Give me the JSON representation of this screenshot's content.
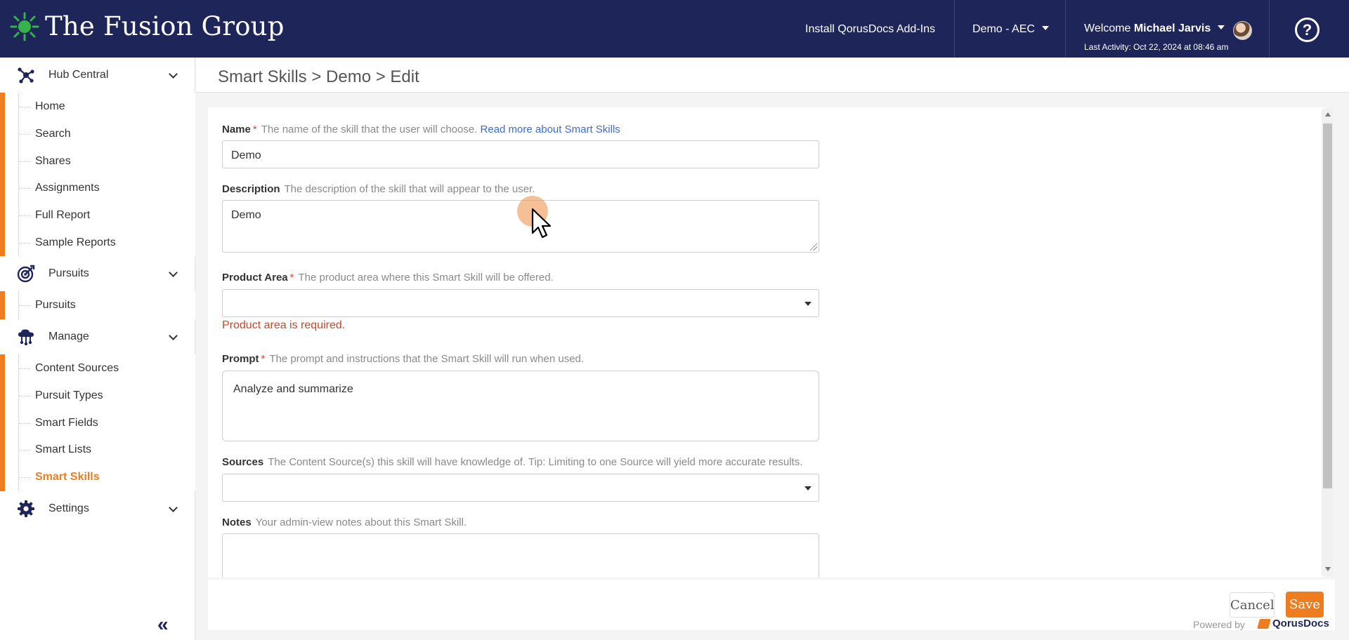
{
  "app": {
    "brand": "The Fusion Group",
    "install_link": "Install QorusDocs Add-Ins",
    "workspace": "Demo - AEC",
    "welcome_prefix": "Welcome",
    "user_name": "Michael Jarvis",
    "last_activity": "Last Activity: Oct 22, 2024 at 08:46 am",
    "help_glyph": "?"
  },
  "sidebar": {
    "sections": [
      {
        "label": "Hub Central",
        "icon": "hub-icon",
        "items": [
          "Home",
          "Search",
          "Shares",
          "Assignments",
          "Full Report",
          "Sample Reports"
        ]
      },
      {
        "label": "Pursuits",
        "icon": "target-icon",
        "items": [
          "Pursuits"
        ]
      },
      {
        "label": "Manage",
        "icon": "cloud-network-icon",
        "items": [
          "Content Sources",
          "Pursuit Types",
          "Smart Fields",
          "Smart Lists",
          "Smart Skills"
        ]
      },
      {
        "label": "Settings",
        "icon": "gear-icon",
        "items": []
      }
    ],
    "active_item": "Smart Skills",
    "collapse_glyph": "«"
  },
  "breadcrumb": "Smart Skills > Demo > Edit",
  "form": {
    "name": {
      "label": "Name",
      "required": "*",
      "hint": "The name of the skill that the user will choose.",
      "link": "Read more about Smart Skills",
      "value": "Demo"
    },
    "description": {
      "label": "Description",
      "hint": "The description of the skill that will appear to the user.",
      "value": "Demo"
    },
    "product_area": {
      "label": "Product Area",
      "required": "*",
      "hint": "The product area where this Smart Skill will be offered.",
      "value": "",
      "error": "Product area is required."
    },
    "prompt": {
      "label": "Prompt",
      "required": "*",
      "hint": "The prompt and instructions that the Smart Skill will run when used.",
      "value": "Analyze  and summarize"
    },
    "sources": {
      "label": "Sources",
      "hint": "The Content Source(s) this skill will have knowledge of. Tip: Limiting to one Source will yield more accurate results.",
      "value": ""
    },
    "notes": {
      "label": "Notes",
      "hint": "Your admin-view notes about this Smart Skill.",
      "value": ""
    }
  },
  "footer": {
    "cancel": "Cancel",
    "save": "Save",
    "powered_by": "Powered by",
    "vendor": "QorusDocs"
  },
  "colors": {
    "header_bg": "#1e2559",
    "accent": "#ee7d1f",
    "link": "#3d6bd1",
    "error": "#c7472b"
  }
}
